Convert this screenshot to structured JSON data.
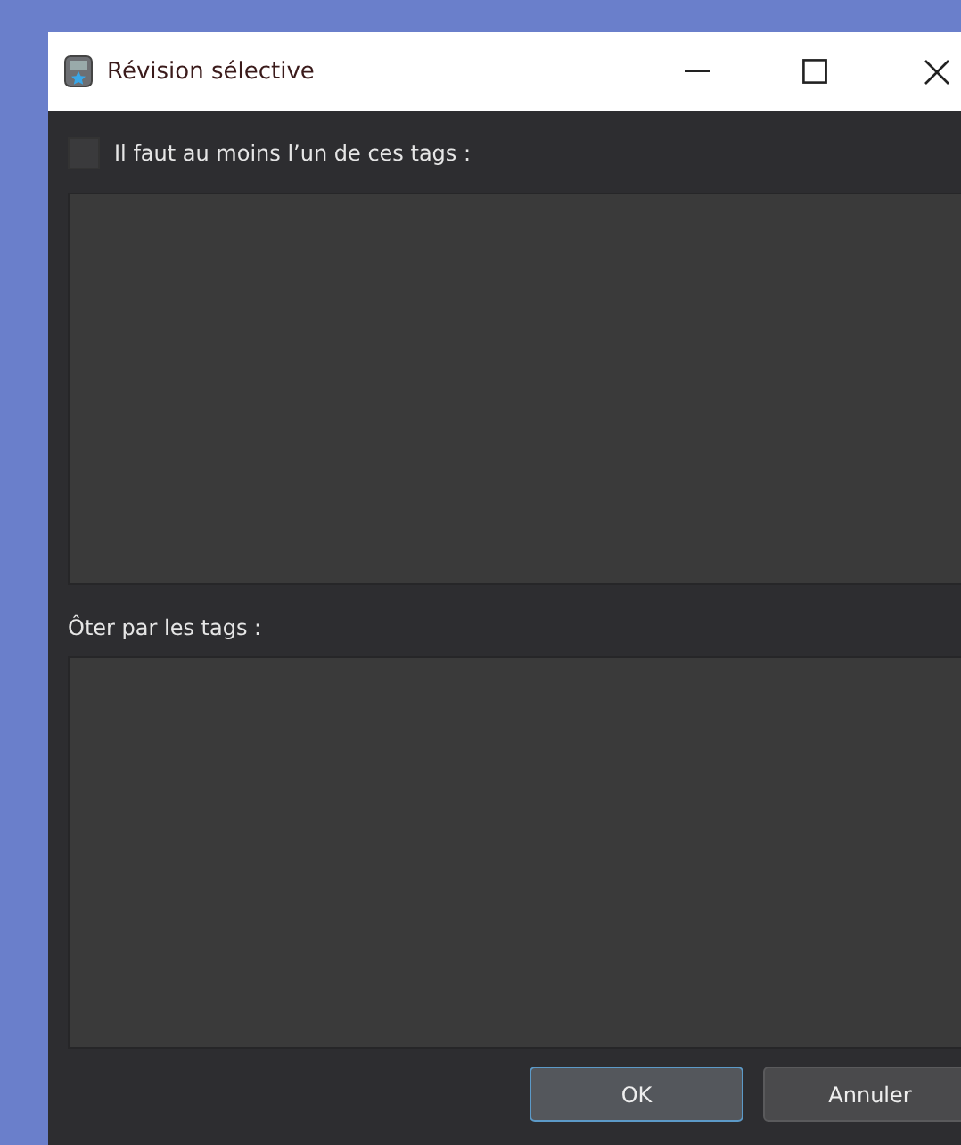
{
  "window": {
    "title": "Révision sélective"
  },
  "require_tags": {
    "label": "Il faut au moins l’un de ces tags :",
    "checked": false
  },
  "remove_tags": {
    "label": "Ôter par les tags :"
  },
  "buttons": [
    {
      "label": "OK",
      "default": true
    },
    {
      "label": "Annuler",
      "default": false
    }
  ]
}
